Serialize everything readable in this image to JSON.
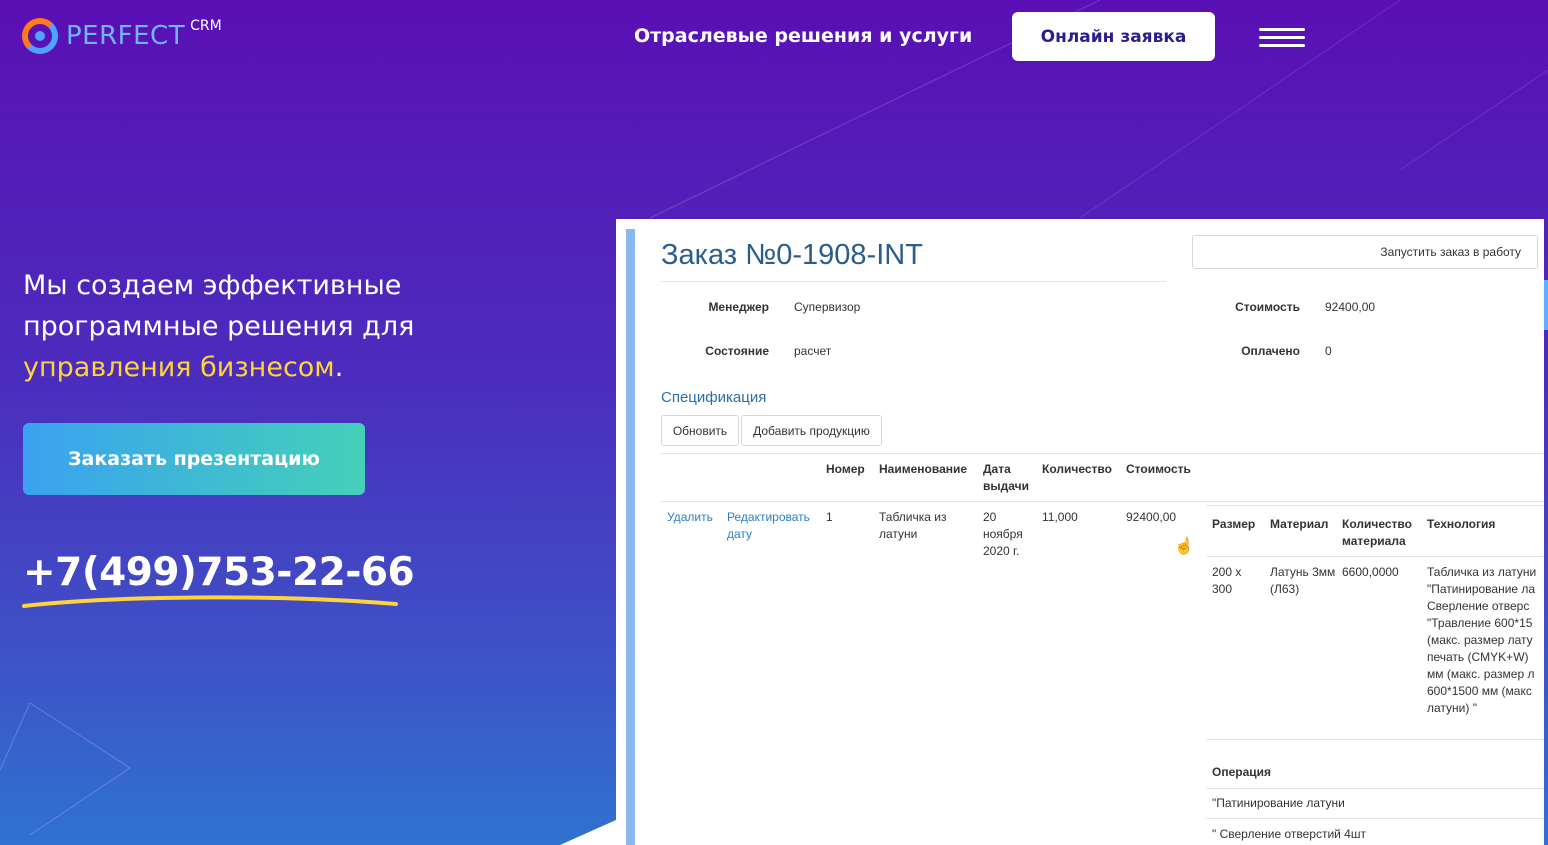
{
  "header": {
    "logo_text": "PERFECT",
    "logo_sup": "CRM",
    "nav_link": "Отраслевые решения и услуги",
    "cta_label": "Онлайн заявка"
  },
  "hero": {
    "headline_part1": "Мы создаем эффективные программные решения для",
    "headline_accent": "управления бизнесом",
    "headline_end": ".",
    "cta_label": "Заказать презентацию",
    "phone": "+7(499)753-22-66"
  },
  "colors": {
    "accent_yellow": "#ffd43b",
    "brand_blue": "#6fb6ff",
    "logo_orange": "#ff7a1a"
  },
  "order": {
    "title": "Заказ №0-1908-INT",
    "run_button": "Запустить заказ в работу",
    "manager_label": "Менеджер",
    "manager_value": "Супервизор",
    "status_label": "Состояние",
    "status_value": "расчет",
    "cost_label": "Стоимость",
    "cost_value": "92400,00",
    "paid_label": "Оплачено",
    "paid_value": "0",
    "spec_title": "Спецификация",
    "refresh_button": "Обновить",
    "add_product_button": "Добавить продукцию",
    "columns": {
      "number": "Номер",
      "name": "Наименование",
      "date": "Дата выдачи",
      "qty": "Количество",
      "cost": "Стоимость"
    },
    "row": {
      "delete": "Удалить",
      "edit_date": "Редактировать дату",
      "number": "1",
      "name": "Табличка из латуни",
      "date": "20 ноября 2020 г.",
      "qty": "11,000",
      "cost": "92400,00"
    },
    "sub_columns": {
      "size": "Размер",
      "material": "Материал",
      "material_qty": "Количество материала",
      "technology": "Технология"
    },
    "sub_row": {
      "size": "200 x 300",
      "material": "Латунь 3мм (Л63)",
      "material_qty": "6600,0000",
      "technology": "Табличка из латуни \"Патинирование ла Сверление отверс \"Травление 600*15 (макс. размер лату печать (CMYK+W) мм (макс. размер л 600*1500 мм (макс латуни) \""
    },
    "operations_label": "Операция",
    "operations": [
      "\"Патинирование латуни",
      "\" Сверление отверстий 4шт"
    ]
  }
}
